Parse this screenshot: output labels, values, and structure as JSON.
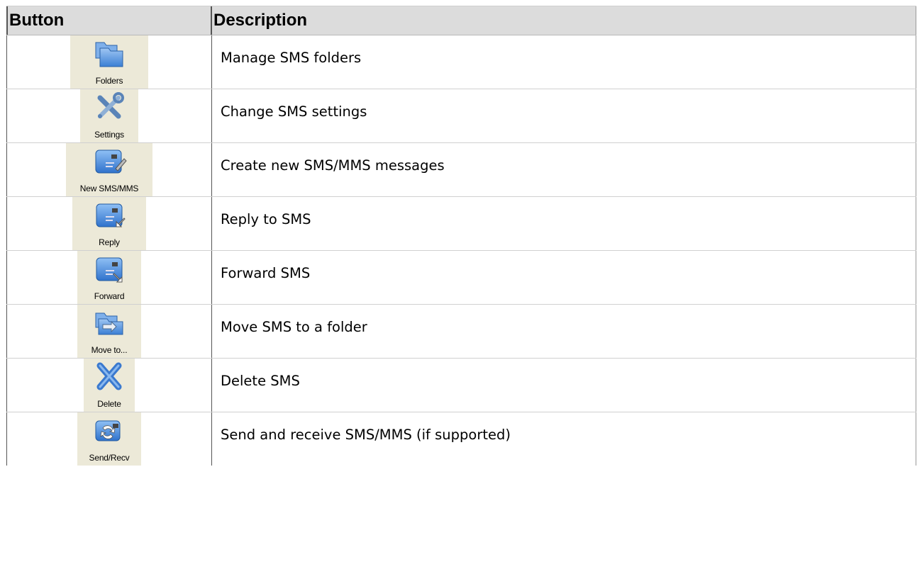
{
  "table": {
    "headers": {
      "button": "Button",
      "description": "Description"
    },
    "rows": [
      {
        "icon": "folders-icon",
        "button_label": "Folders",
        "description": "Manage SMS folders"
      },
      {
        "icon": "settings-icon",
        "button_label": "Settings",
        "description": "Change SMS settings"
      },
      {
        "icon": "new-message-icon",
        "button_label": "New SMS/MMS",
        "description": "Create new SMS/MMS messages"
      },
      {
        "icon": "reply-icon",
        "button_label": "Reply",
        "description": "Reply to SMS"
      },
      {
        "icon": "forward-icon",
        "button_label": "Forward",
        "description": "Forward SMS"
      },
      {
        "icon": "move-to-folder-icon",
        "button_label": "Move to...",
        "description": "Move SMS to a folder"
      },
      {
        "icon": "delete-icon",
        "button_label": "Delete",
        "description": "Delete SMS"
      },
      {
        "icon": "send-receive-icon",
        "button_label": "Send/Recv",
        "description": "Send and receive SMS/MMS (if supported)"
      }
    ]
  },
  "colors": {
    "header_bg": "#dcdcdc",
    "button_bg": "#ece9d8",
    "icon_blue": "#4a8fd8"
  }
}
